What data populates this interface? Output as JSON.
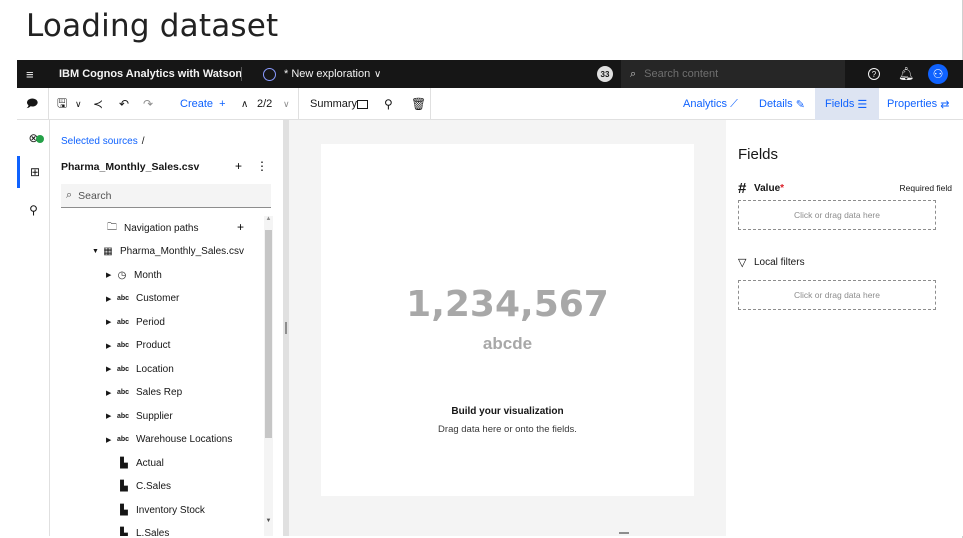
{
  "slide": {
    "title": "Loading dataset"
  },
  "topbar": {
    "brand": "IBM Cognos Analytics with Watson",
    "exploration_title": "* New exploration",
    "badge": "33",
    "search_placeholder": "Search content"
  },
  "toolbar": {
    "create_label": "Create",
    "page_indicator": "2/2",
    "summary_label": "Summary",
    "analytics_label": "Analytics",
    "details_label": "Details",
    "fields_label": "Fields",
    "properties_label": "Properties"
  },
  "source_panel": {
    "breadcrumb": "Selected sources",
    "breadcrumb_sep": "/",
    "source_name": "Pharma_Monthly_Sales.csv",
    "search_placeholder": "Search",
    "tree": [
      {
        "label": "Navigation paths",
        "icon": "folder-icon",
        "glyph": "🗀",
        "caret": "",
        "indent": 0
      },
      {
        "label": "Pharma_Monthly_Sales.csv",
        "icon": "table-icon",
        "glyph": "▦",
        "caret": "▼",
        "indent": 1
      },
      {
        "label": "Month",
        "icon": "clock-icon",
        "glyph": "◷",
        "caret": "▶",
        "indent": 2
      },
      {
        "label": "Customer",
        "icon": "abc-icon",
        "glyph": "abc",
        "caret": "▶",
        "indent": 2
      },
      {
        "label": "Period",
        "icon": "abc-icon",
        "glyph": "abc",
        "caret": "▶",
        "indent": 2
      },
      {
        "label": "Product",
        "icon": "abc-icon",
        "glyph": "abc",
        "caret": "▶",
        "indent": 2
      },
      {
        "label": "Location",
        "icon": "abc-icon",
        "glyph": "abc",
        "caret": "▶",
        "indent": 2
      },
      {
        "label": "Sales Rep",
        "icon": "abc-icon",
        "glyph": "abc",
        "caret": "▶",
        "indent": 2
      },
      {
        "label": "Supplier",
        "icon": "abc-icon",
        "glyph": "abc",
        "caret": "▶",
        "indent": 2
      },
      {
        "label": "Warehouse Locations",
        "icon": "abc-icon",
        "glyph": "abc",
        "caret": "▶",
        "indent": 2
      },
      {
        "label": "Actual",
        "icon": "measure-icon",
        "glyph": "▙",
        "caret": "",
        "indent": 3
      },
      {
        "label": "C.Sales",
        "icon": "measure-icon",
        "glyph": "▙",
        "caret": "",
        "indent": 3
      },
      {
        "label": "Inventory Stock",
        "icon": "measure-icon",
        "glyph": "▙",
        "caret": "",
        "indent": 3
      },
      {
        "label": "L.Sales",
        "icon": "measure-icon",
        "glyph": "▙",
        "caret": "",
        "indent": 3
      }
    ]
  },
  "canvas": {
    "value": "1,234,567",
    "subtitle": "abcde",
    "build_title": "Build your visualization",
    "build_hint": "Drag data here or onto the fields."
  },
  "fields_panel": {
    "title": "Fields",
    "value_label": "Value",
    "required_marker": "*",
    "required_text": "Required field",
    "drop_hint_value": "Click or drag data here",
    "local_filters_label": "Local filters",
    "drop_hint_filters": "Click or drag data here"
  }
}
